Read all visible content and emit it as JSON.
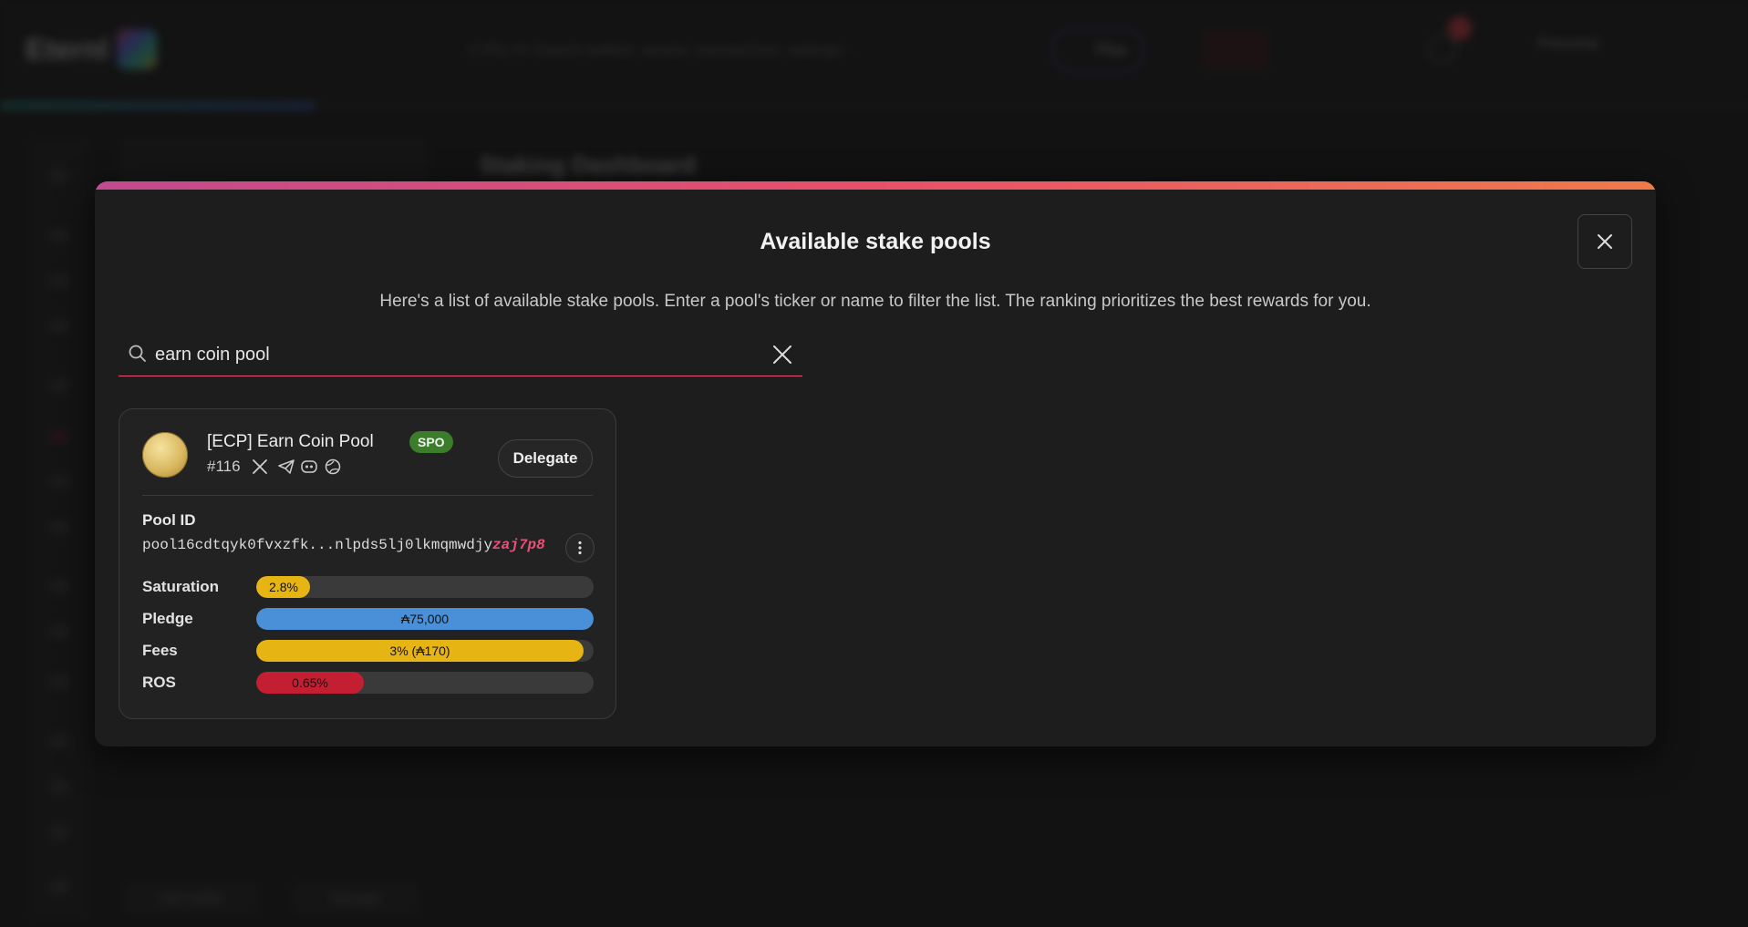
{
  "background": {
    "logo": "Eternl",
    "search_placeholder": "CTRL+K Search wallets, assets, transactions, settings ...",
    "plan_label": "Plus",
    "account_label": "Personal",
    "page_title": "Staking Dashboard",
    "footer_buttons": [
      "Add wallet",
      "Manage"
    ]
  },
  "modal": {
    "title": "Available stake pools",
    "description": "Here's a list of available stake pools. Enter a pool's ticker or name to filter the list. The ranking prioritizes the best rewards for you.",
    "search": {
      "value": "earn coin pool",
      "placeholder": ""
    },
    "colors": {
      "accent": "#e8507a",
      "saturation": "#e6b514",
      "pledge": "#4a90d9",
      "fees": "#e6b514",
      "ros": "#c41e32"
    }
  },
  "pool": {
    "name": "[ECP] Earn Coin Pool",
    "badge": "SPO",
    "rank": "#116",
    "socials": [
      "x-icon",
      "telegram-icon",
      "discord-icon",
      "globe-icon"
    ],
    "delegate_label": "Delegate",
    "pool_id_label": "Pool ID",
    "pool_id_prefix": "pool16cdtqyk0fvxzfk...nlpds5lj0lkmqmwdjy",
    "pool_id_suffix": "zaj7p8",
    "metrics": [
      {
        "label": "Saturation",
        "value_text": "2.8%",
        "fill": 0.16,
        "color": "#e6b514"
      },
      {
        "label": "Pledge",
        "value_text": "₳75,000",
        "fill": 1.0,
        "color": "#4a90d9"
      },
      {
        "label": "Fees",
        "value_text": "3% (₳170)",
        "fill": 0.97,
        "color": "#e6b514"
      },
      {
        "label": "ROS",
        "value_text": "0.65%",
        "fill": 0.32,
        "color": "#c41e32"
      }
    ]
  }
}
